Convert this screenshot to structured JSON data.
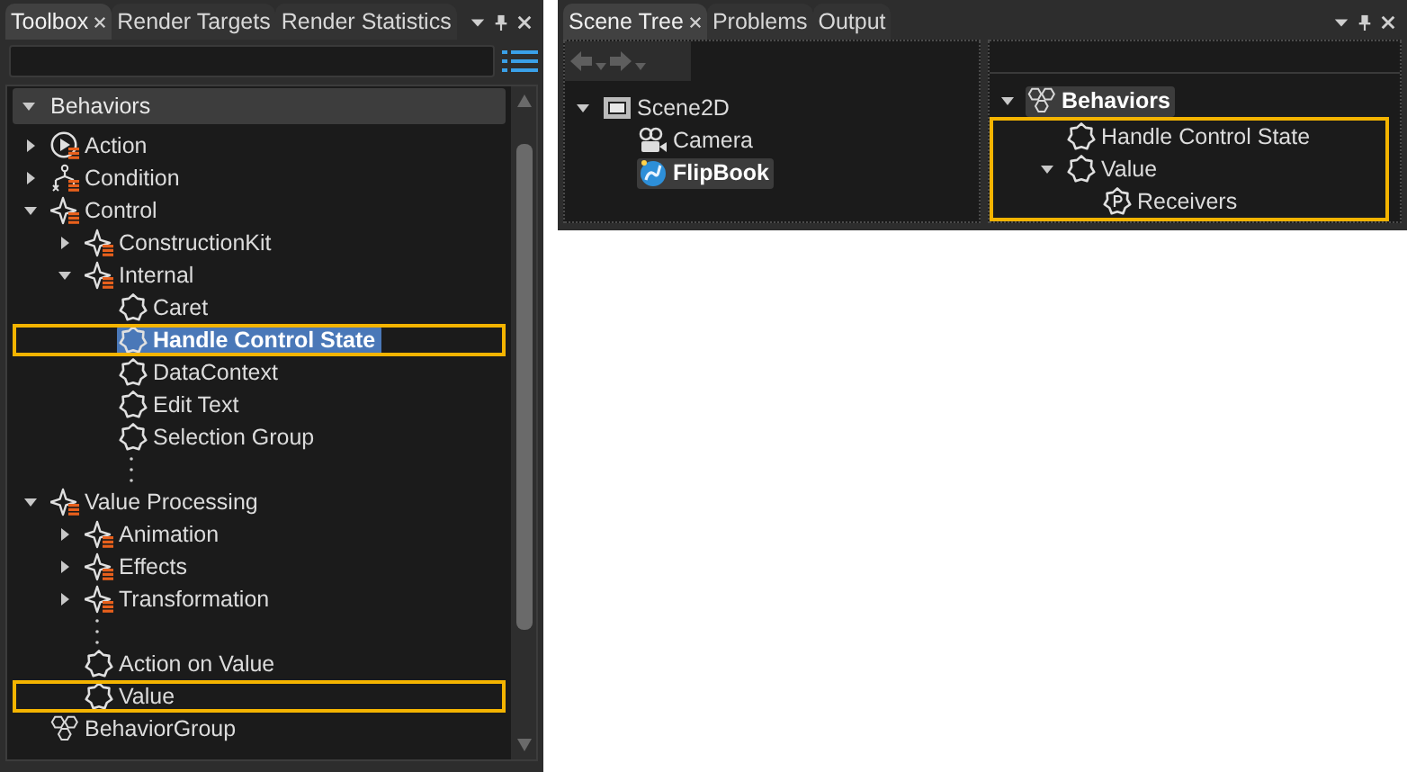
{
  "toolbox": {
    "tabs": [
      {
        "label": "Toolbox",
        "selected": true,
        "closable": true
      },
      {
        "label": "Render Targets",
        "selected": false,
        "closable": false
      },
      {
        "label": "Render Statistics",
        "selected": false,
        "closable": false
      }
    ],
    "tree": {
      "header": {
        "label": "Behaviors",
        "expanded": true
      },
      "items": [
        {
          "kind": "action",
          "label": "Action",
          "expanded": false,
          "selected": false,
          "highlighted": false
        },
        {
          "kind": "condition",
          "label": "Condition",
          "expanded": false,
          "selected": false,
          "highlighted": false
        },
        {
          "kind": "category",
          "label": "Control",
          "expanded": true,
          "selected": false,
          "highlighted": false,
          "children": [
            {
              "kind": "category",
              "label": "ConstructionKit",
              "expanded": false,
              "selected": false,
              "highlighted": false
            },
            {
              "kind": "category",
              "label": "Internal",
              "expanded": true,
              "selected": false,
              "highlighted": false,
              "children": [
                {
                  "kind": "behavior",
                  "label": "Caret",
                  "selected": false,
                  "highlighted": false
                },
                {
                  "kind": "behavior",
                  "label": "Handle Control State",
                  "selected": true,
                  "highlighted": true
                },
                {
                  "kind": "behavior",
                  "label": "DataContext",
                  "selected": false,
                  "highlighted": false
                },
                {
                  "kind": "behavior",
                  "label": "Edit Text",
                  "selected": false,
                  "highlighted": false
                },
                {
                  "kind": "behavior",
                  "label": "Selection Group",
                  "selected": false,
                  "highlighted": false
                },
                {
                  "kind": "more"
                }
              ]
            }
          ]
        },
        {
          "kind": "category",
          "label": "Value Processing",
          "expanded": true,
          "selected": false,
          "highlighted": false,
          "children": [
            {
              "kind": "category",
              "label": "Animation",
              "expanded": false,
              "selected": false,
              "highlighted": false
            },
            {
              "kind": "category",
              "label": "Effects",
              "expanded": false,
              "selected": false,
              "highlighted": false
            },
            {
              "kind": "category",
              "label": "Transformation",
              "expanded": false,
              "selected": false,
              "highlighted": false
            },
            {
              "kind": "more"
            },
            {
              "kind": "behavior",
              "label": "Action on Value",
              "selected": false,
              "highlighted": false
            },
            {
              "kind": "behavior",
              "label": "Value",
              "selected": false,
              "highlighted": true
            }
          ]
        },
        {
          "kind": "group",
          "label": "BehaviorGroup",
          "selected": false,
          "highlighted": false
        }
      ]
    }
  },
  "scene": {
    "tabs": [
      {
        "label": "Scene Tree",
        "selected": true,
        "closable": true
      },
      {
        "label": "Problems",
        "selected": false,
        "closable": false
      },
      {
        "label": "Output",
        "selected": false,
        "closable": false
      }
    ],
    "scene_tree": {
      "items": [
        {
          "kind": "scene",
          "label": "Scene2D",
          "expanded": true,
          "selected": false,
          "highlighted": false,
          "children": [
            {
              "kind": "camera",
              "label": "Camera",
              "selected": false,
              "highlighted": false
            },
            {
              "kind": "flipbook",
              "label": "FlipBook",
              "selected": true,
              "highlighted": false
            }
          ]
        }
      ]
    },
    "behavior_tree": {
      "items": [
        {
          "kind": "group",
          "label": "Behaviors",
          "expanded": true,
          "selected": true,
          "highlighted": false,
          "children_highlighted": true,
          "children": [
            {
              "kind": "behavior",
              "label": "Handle Control State",
              "selected": false,
              "highlighted": false
            },
            {
              "kind": "behavior",
              "label": "Value",
              "expanded": true,
              "selected": false,
              "highlighted": false,
              "children": [
                {
                  "kind": "property",
                  "label": "Receivers",
                  "selected": false,
                  "highlighted": false
                }
              ]
            }
          ]
        }
      ]
    }
  }
}
